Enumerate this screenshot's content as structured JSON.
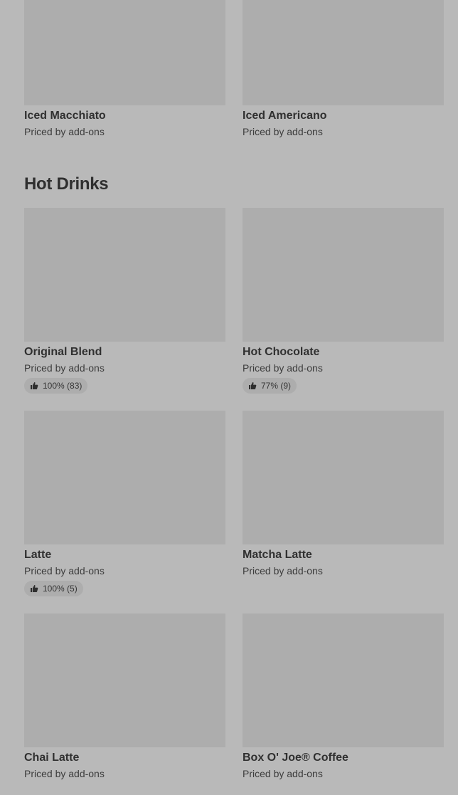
{
  "top_items": [
    {
      "name": "Iced Macchiato",
      "price": "Priced by add-ons"
    },
    {
      "name": "Iced Americano",
      "price": "Priced by add-ons"
    }
  ],
  "hot_drinks": {
    "title": "Hot Drinks",
    "items": [
      {
        "name": "Original Blend",
        "price": "Priced by add-ons",
        "rating": "100% (83)"
      },
      {
        "name": "Hot Chocolate",
        "price": "Priced by add-ons",
        "rating": "77% (9)"
      },
      {
        "name": "Latte",
        "price": "Priced by add-ons",
        "rating": "100% (5)"
      },
      {
        "name": "Matcha Latte",
        "price": "Priced by add-ons"
      },
      {
        "name": "Chai Latte",
        "price": "Priced by add-ons"
      },
      {
        "name": "Box O' Joe® Coffee",
        "price": "Priced by add-ons"
      }
    ]
  },
  "icons": {
    "rating": "thumbs-up-icon"
  }
}
